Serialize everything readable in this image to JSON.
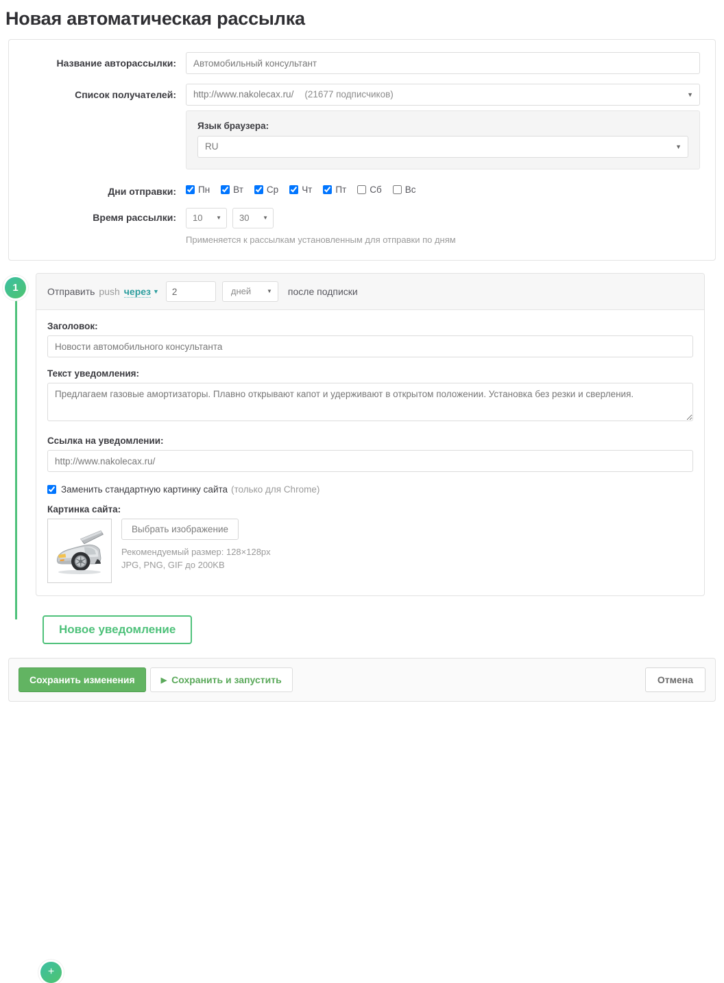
{
  "page": {
    "title": "Новая автоматическая рассылка"
  },
  "settings": {
    "name_label": "Название авторассылки:",
    "name_value": "Автомобильный консультант",
    "recipients_label": "Список получателей:",
    "recipients_value": "http://www.nakolecax.ru/",
    "recipients_count": "(21677 подписчиков)",
    "language_label": "Язык браузера:",
    "language_value": "RU",
    "days_label": "Дни отправки:",
    "days": [
      {
        "label": "Пн",
        "checked": true
      },
      {
        "label": "Вт",
        "checked": true
      },
      {
        "label": "Ср",
        "checked": true
      },
      {
        "label": "Чт",
        "checked": true
      },
      {
        "label": "Пт",
        "checked": true
      },
      {
        "label": "Сб",
        "checked": false
      },
      {
        "label": "Вс",
        "checked": false
      }
    ],
    "time_label": "Время рассылки:",
    "time_hour": "10",
    "time_minute": "30",
    "time_hint": "Применяется к рассылкам установленным для отправки по дням"
  },
  "notification": {
    "step_number": "1",
    "head_lead": "Отправить",
    "head_push": "push",
    "head_link": "через",
    "delay_value": "2",
    "delay_unit": "дней",
    "head_after": "после подписки",
    "title_label": "Заголовок:",
    "title_value": "Новости автомобильного консультанта",
    "text_label": "Текст уведомления:",
    "text_value": "Предлагаем газовые амортизаторы. Плавно открывают капот и удерживают в открытом положении. Установка без резки и сверления.",
    "link_label": "Ссылка на уведомлении:",
    "link_value": "http://www.nakolecax.ru/",
    "replace_checkbox_label": "Заменить стандартную картинку сайта",
    "replace_checkbox_note": "(только для Chrome)",
    "replace_checked": true,
    "image_label": "Картинка сайта:",
    "choose_image_button": "Выбрать изображение",
    "image_note_size": "Рекомендуемый размер: 128×128px",
    "image_note_formats": "JPG, PNG, GIF до 200KB",
    "image_alt": "car-with-open-hood-thumbnail"
  },
  "actions": {
    "add_step_icon": "+",
    "new_notification_button": "Новое уведомление",
    "save_button": "Сохранить изменения",
    "save_and_run_button": "Сохранить и запустить",
    "cancel_button": "Отмена"
  },
  "colors": {
    "brand_green": "#4ec17a",
    "save_green": "#62b462",
    "teal_link": "#2a9d9d"
  }
}
